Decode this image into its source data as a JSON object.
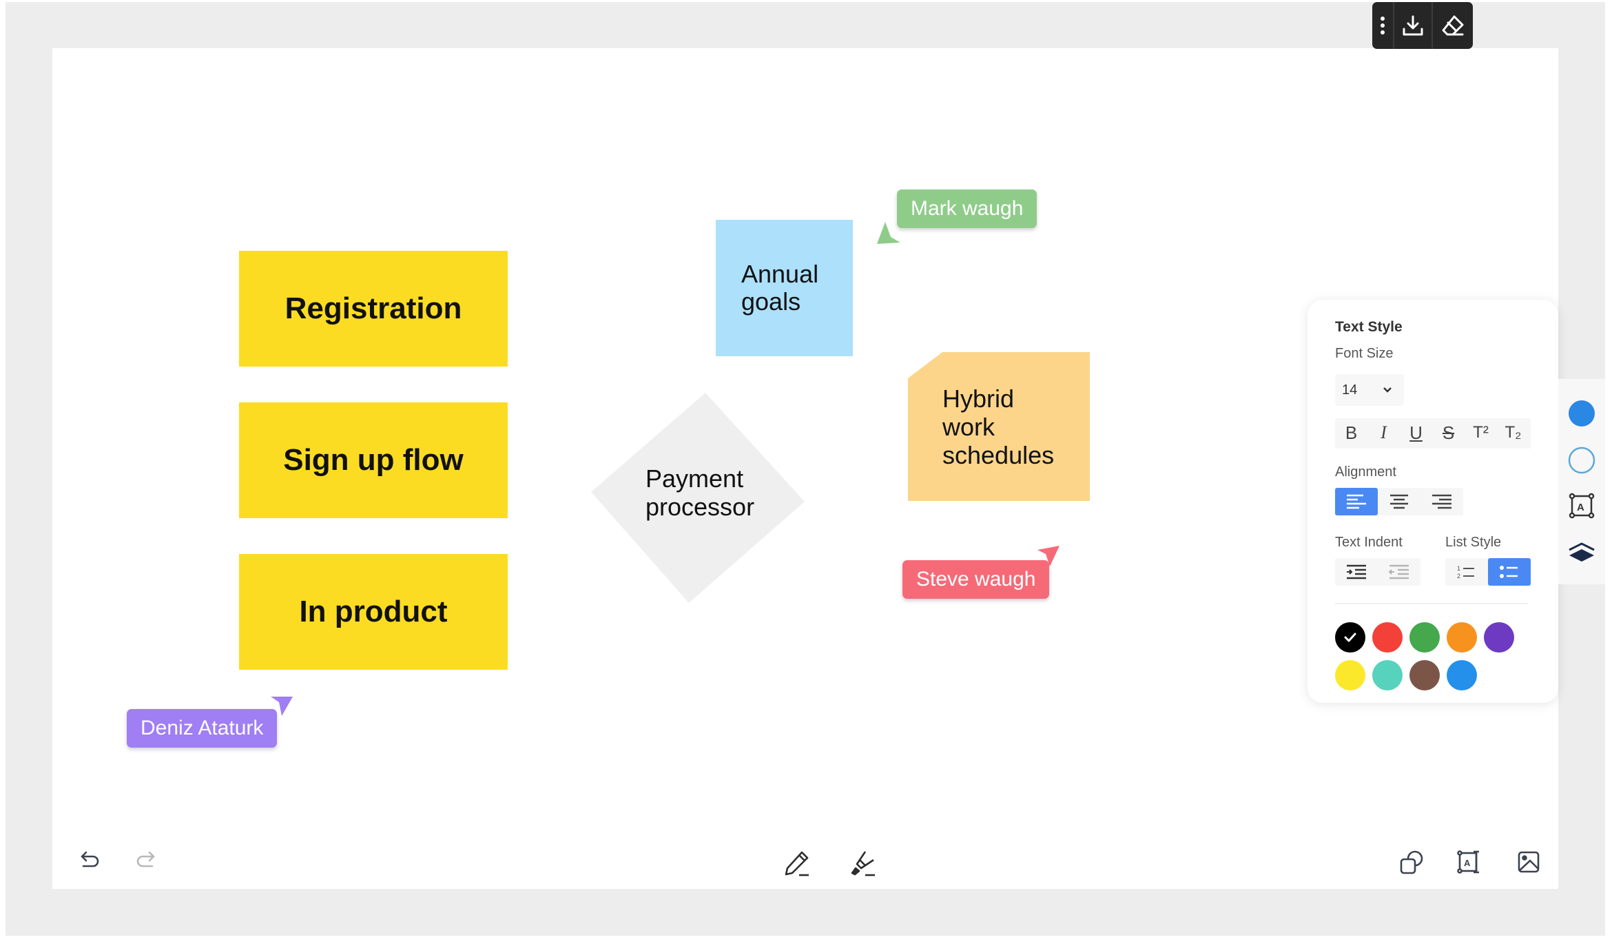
{
  "top_toolbar": {
    "items": [
      {
        "icon": "more-vertical-icon",
        "label": "More options"
      },
      {
        "icon": "download-icon",
        "label": "Download"
      },
      {
        "icon": "eraser-icon",
        "label": "Eraser"
      }
    ]
  },
  "canvas": {
    "sticky_notes": [
      {
        "text": "Registration",
        "color": "#fcdc22"
      },
      {
        "text": "Sign up flow",
        "color": "#fcdc22"
      },
      {
        "text": "In product",
        "color": "#fcdc22"
      },
      {
        "text": "Annual\ngoals",
        "color": "#ace0fb"
      },
      {
        "text": "Hybrid\nwork\nschedules",
        "color": "#fcd58b"
      }
    ],
    "diamond": {
      "text": "Payment\nprocessor",
      "color": "#efefef"
    },
    "cursors": [
      {
        "name": "Mark waugh",
        "color": "#8fcc8a"
      },
      {
        "name": "Steve waugh",
        "color": "#f66a78"
      },
      {
        "name": "Deniz Ataturk",
        "color": "#a07ef3"
      }
    ]
  },
  "text_style_panel": {
    "title": "Text Style",
    "font_size_label": "Font Size",
    "font_size_value": "14",
    "format_buttons": [
      {
        "label": "B",
        "name": "bold"
      },
      {
        "label": "I",
        "name": "italic"
      },
      {
        "label": "U",
        "name": "underline"
      },
      {
        "label": "S",
        "name": "strikethrough"
      },
      {
        "label": "T²",
        "name": "superscript"
      },
      {
        "label": "T₂",
        "name": "subscript"
      }
    ],
    "alignment_label": "Alignment",
    "alignment_options": [
      "left",
      "center",
      "right"
    ],
    "alignment_selected": "left",
    "text_indent_label": "Text Indent",
    "indent_options": [
      "increase-indent",
      "decrease-indent"
    ],
    "list_style_label": "List Style",
    "list_options": [
      "numbered-list",
      "bulleted-list"
    ],
    "list_selected": "bulleted-list",
    "colors": [
      "#000000",
      "#f3413a",
      "#45a84c",
      "#f8921f",
      "#6d3ac1",
      "#fce82a",
      "#57d3bd",
      "#7c5549",
      "#2490ec"
    ],
    "selected_color": "#000000",
    "accent": "#4a89f3"
  },
  "side_toolbar": {
    "items": [
      {
        "icon": "fill-color-icon",
        "color": "#2a87e4"
      },
      {
        "icon": "border-color-icon",
        "color": "#5aa8dc"
      },
      {
        "icon": "text-box-icon"
      },
      {
        "icon": "layers-icon"
      }
    ]
  },
  "bottom_toolbar": {
    "left": [
      {
        "icon": "undo-icon",
        "enabled": true
      },
      {
        "icon": "redo-icon",
        "enabled": false
      }
    ],
    "center": [
      {
        "icon": "pen-icon"
      },
      {
        "icon": "highlighter-icon"
      }
    ],
    "right": [
      {
        "icon": "shapes-icon"
      },
      {
        "icon": "text-box-icon"
      },
      {
        "icon": "image-icon"
      }
    ]
  }
}
